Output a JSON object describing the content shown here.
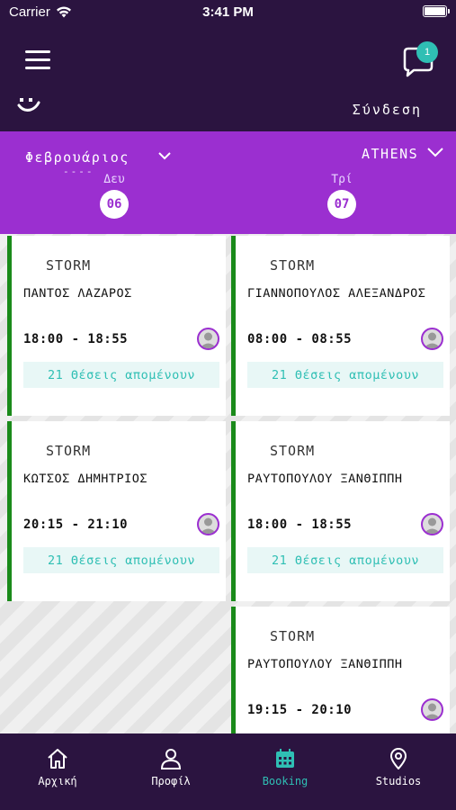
{
  "status_bar": {
    "carrier": "Carrier",
    "time": "3:41 PM"
  },
  "header": {
    "chat_badge_count": "1",
    "login_label": "Σύνδεση"
  },
  "date_bar": {
    "month": "Φεβρουάριος",
    "month_dashes": "----",
    "city": "ATHENS",
    "days": [
      {
        "name": "Δευ",
        "number": "06"
      },
      {
        "name": "Τρί",
        "number": "07"
      }
    ]
  },
  "columns": [
    {
      "cards": [
        {
          "studio": "STORM",
          "coach": "ΠΑΝΤΟΣ ΛΑΖΑΡΟΣ",
          "time": "18:00 - 18:55",
          "seats": "21 Θέσεις απομένουν"
        },
        {
          "studio": "STORM",
          "coach": "ΚΩΤΣΟΣ ΔΗΜΗΤΡΙΟΣ",
          "time": "20:15 - 21:10",
          "seats": "21 Θέσεις απομένουν"
        }
      ]
    },
    {
      "cards": [
        {
          "studio": "STORM",
          "coach": "ΓΙΑΝΝΟΠΟΥΛΟΣ ΑΛΕΞΑΝΔΡΟΣ",
          "time": "08:00 - 08:55",
          "seats": "21 Θέσεις απομένουν"
        },
        {
          "studio": "STORM",
          "coach": "ΡΑΥΤΟΠΟΥΛΟΥ ΞΑΝΘΙΠΠΗ",
          "time": "18:00 - 18:55",
          "seats": "21 Θέσεις απομένουν"
        },
        {
          "studio": "STORM",
          "coach": "ΡΑΥΤΟΠΟΥΛΟΥ ΞΑΝΘΙΠΠΗ",
          "time": "19:15 - 20:10",
          "seats": ""
        }
      ]
    }
  ],
  "tabs": [
    {
      "label": "Αρχική",
      "icon": "home-icon"
    },
    {
      "label": "Προφίλ",
      "icon": "user-icon"
    },
    {
      "label": "Booking",
      "icon": "calendar-icon",
      "active": true
    },
    {
      "label": "Studios",
      "icon": "map-pin-icon"
    }
  ],
  "colors": {
    "header_bg": "#2b1440",
    "date_bar_bg": "#9b2fd0",
    "accent_teal": "#2fbfb4",
    "card_border_green": "#1a8a1a"
  }
}
